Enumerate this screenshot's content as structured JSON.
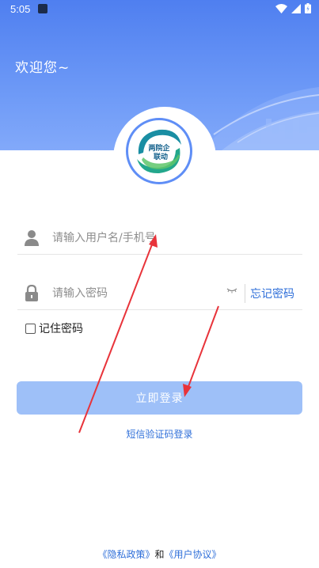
{
  "status_bar": {
    "time": "5:05",
    "icons": [
      "wifi-icon",
      "signal-icon",
      "battery-icon"
    ]
  },
  "header": {
    "greeting": "欢迎您~"
  },
  "logo": {
    "text_line1": "两院企",
    "text_line2": "联动"
  },
  "login_form": {
    "username_placeholder": "请输入用户名/手机号",
    "password_placeholder": "请输入密码",
    "forgot_password": "忘记密码",
    "remember_password": "记住密码",
    "login_button": "立即登录",
    "sms_login": "短信验证码登录"
  },
  "agreement": {
    "privacy_policy": "《隐私政策》",
    "conjunction": "和",
    "user_agreement": "《用户协议》"
  },
  "colors": {
    "header_blue": "#5f8ef6",
    "login_button": "#9ec0f8",
    "link_blue": "#2f6fd9",
    "annotation_red": "#e8333a"
  }
}
